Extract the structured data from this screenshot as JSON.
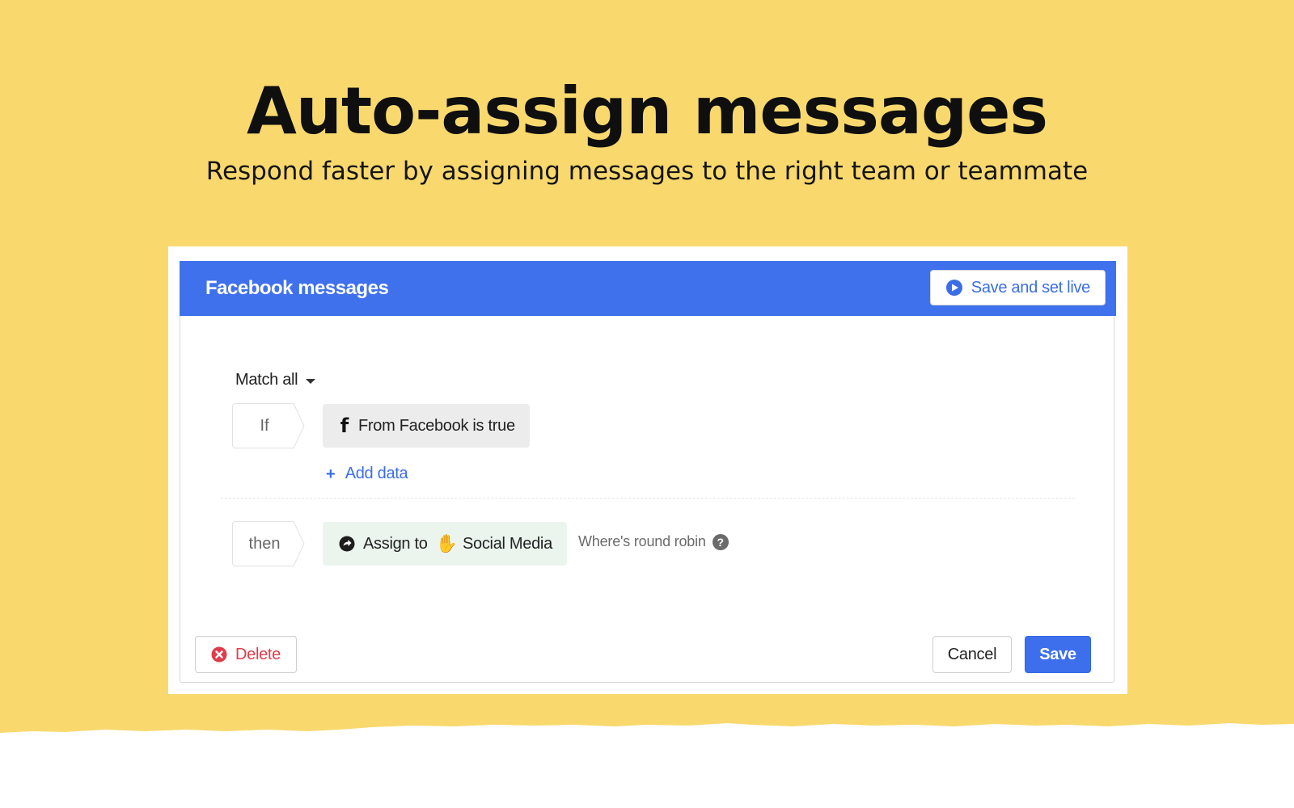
{
  "hero": {
    "title": "Auto-assign messages",
    "subtitle": "Respond faster by assigning messages to the right team or teammate"
  },
  "rule": {
    "name": "Facebook messages",
    "save_live_label": "Save and set live",
    "match_label": "Match all",
    "if_label": "If",
    "condition_label": "From Facebook is true",
    "add_data_label": "Add data",
    "then_label": "then",
    "action_prefix": "Assign to",
    "action_team": "Social Media",
    "round_robin_label": "Where's round robin",
    "delete_label": "Delete",
    "cancel_label": "Cancel",
    "save_label": "Save"
  },
  "icons": {
    "save_live": "play-circle-icon",
    "match_dropdown": "caret-down-icon",
    "condition": "facebook-icon",
    "add_data": "plus-icon",
    "action": "assign-arrow-icon",
    "team": "raised-hands-icon",
    "round_robin": "help-icon",
    "delete": "x-circle-icon"
  },
  "colors": {
    "background": "#f9d96e",
    "header": "#4071ec",
    "accent": "#3a6ee8",
    "danger": "#e03c4a",
    "action_chip": "#ebf5ee",
    "condition_chip": "#ececec"
  }
}
